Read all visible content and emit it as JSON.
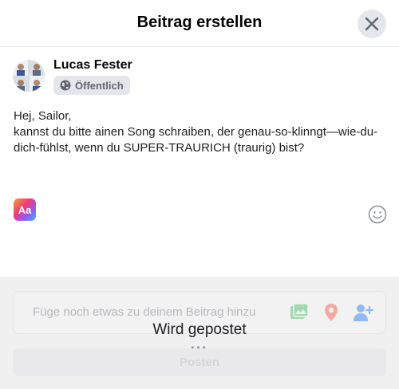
{
  "dialog": {
    "title": "Beitrag erstellen"
  },
  "author": {
    "name": "Lucas Fester",
    "audience": "Öffentlich"
  },
  "post": {
    "text": "Hej, Sailor,\nkannst du bitte ainen Song schraiben, der genau-so-klinngt—wie-du-dich-fühlst, wenn du SUPER-TRAURICH (traurig) bist?"
  },
  "composer": {
    "text_format_label": "Aa"
  },
  "add_to_post": {
    "label": "Füge noch etwas zu deinem Beitrag hinzu",
    "icons": [
      "photo-icon",
      "location-pin-icon",
      "tag-people-icon"
    ]
  },
  "status": {
    "posting_label": "Wird gepostet",
    "spinner": "•••"
  },
  "actions": {
    "post_label": "Posten"
  },
  "colors": {
    "photo": "#45bd62",
    "location": "#f5533d",
    "tag": "#1877f2"
  }
}
